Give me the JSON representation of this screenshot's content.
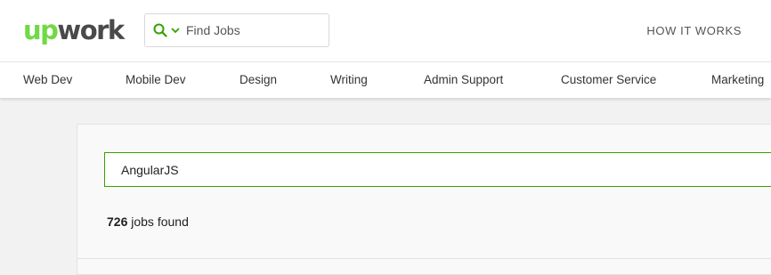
{
  "brand": {
    "logo_up": "up",
    "logo_work": "work",
    "accent_color": "#6fda44"
  },
  "header": {
    "search_placeholder": "Find Jobs",
    "search_icon": "search-icon",
    "dropdown_icon": "chevron-down-icon",
    "how_it_works": "HOW IT WORKS"
  },
  "categories": [
    {
      "label": "Web Dev"
    },
    {
      "label": "Mobile Dev"
    },
    {
      "label": "Design"
    },
    {
      "label": "Writing"
    },
    {
      "label": "Admin Support"
    },
    {
      "label": "Customer Service"
    },
    {
      "label": "Marketing"
    }
  ],
  "search": {
    "query": "AngularJS",
    "results_count": "726",
    "results_suffix": " jobs found"
  }
}
